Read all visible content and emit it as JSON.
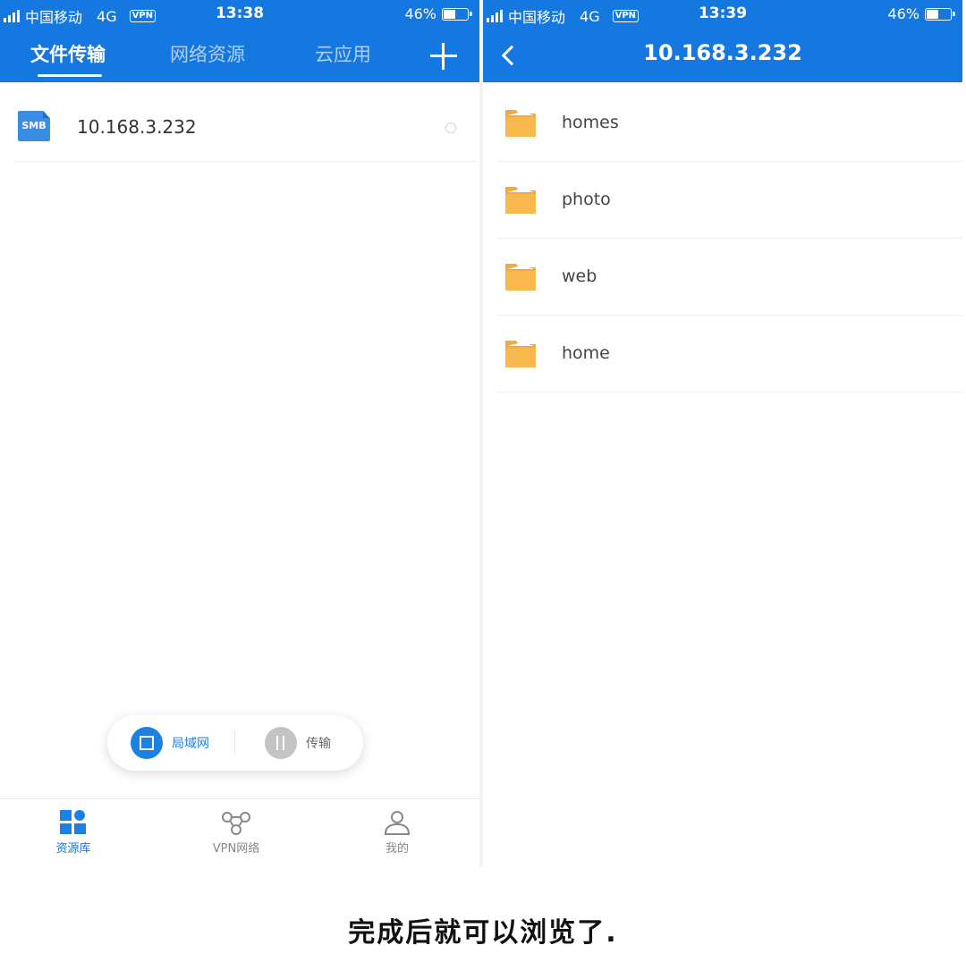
{
  "left_screen": {
    "status": {
      "carrier": "中国移动",
      "network": "4G",
      "vpn": "VPN",
      "time": "13:38",
      "battery": "46%",
      "battery_level": 0.46
    },
    "tabs": [
      {
        "label": "文件传输",
        "active": true
      },
      {
        "label": "网络资源",
        "active": false
      },
      {
        "label": "云应用",
        "active": false
      }
    ],
    "server": {
      "badge": "SMB",
      "name": "10.168.3.232"
    },
    "pill": {
      "lan_label": "局域网",
      "transfer_label": "传输"
    },
    "bottom_nav": [
      {
        "label": "资源库",
        "active": true
      },
      {
        "label": "VPN网络",
        "active": false
      },
      {
        "label": "我的",
        "active": false
      }
    ]
  },
  "right_screen": {
    "status": {
      "carrier": "中国移动",
      "network": "4G",
      "vpn": "VPN",
      "time": "13:39",
      "battery": "46%",
      "battery_level": 0.46
    },
    "title": "10.168.3.232",
    "folders": [
      {
        "name": "homes"
      },
      {
        "name": "photo"
      },
      {
        "name": "web"
      },
      {
        "name": "home"
      }
    ]
  },
  "caption": "完成后就可以浏览了.",
  "colors": {
    "accent": "#1577e0",
    "folder": "#f8b84e"
  }
}
